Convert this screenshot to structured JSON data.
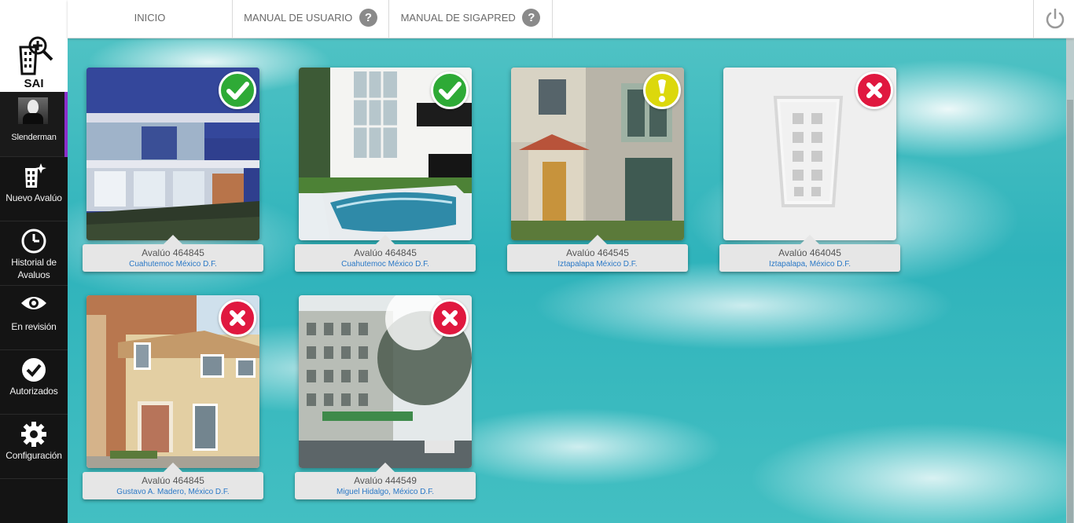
{
  "sidebar": {
    "logo_text": "SAI",
    "user_name": "Slenderman",
    "items": [
      {
        "label": "Nuevo Avalúo",
        "icon": "building-plus-icon"
      },
      {
        "label": "Historial de Avaluos",
        "icon": "clock-icon"
      },
      {
        "label": "En revisión",
        "icon": "eye-icon"
      },
      {
        "label": "Autorizados",
        "icon": "check-circle-icon"
      },
      {
        "label": "Configuración",
        "icon": "gear-icon"
      }
    ]
  },
  "topbar": {
    "nav": [
      {
        "label": "INICIO"
      },
      {
        "label": "MANUAL DE USUARIO",
        "help": "?"
      },
      {
        "label": "MANUAL DE SIGAPRED",
        "help": "?"
      }
    ],
    "power_icon": "power-icon"
  },
  "cards": [
    {
      "title": "Avalúo 464845",
      "location": "Cuahutemoc México D.F.",
      "status": "approved",
      "status_color": "#2eaa36"
    },
    {
      "title": "Avalúo 464845",
      "location": "Cuahutemoc México D.F.",
      "status": "approved",
      "status_color": "#2eaa36"
    },
    {
      "title": "Avalúo 464545",
      "location": "Iztapalapa México D.F.",
      "status": "warning",
      "status_color": "#dcd80c"
    },
    {
      "title": "Avalúo 464045",
      "location": "Iztapalapa, México D.F.",
      "status": "rejected",
      "status_color": "#e0183f"
    },
    {
      "title": "Avalúo 464845",
      "location": "Gustavo A. Madero, México D.F.",
      "status": "rejected",
      "status_color": "#e0183f"
    },
    {
      "title": "Avalúo 444549",
      "location": "Miguel Hidalgo, México D.F.",
      "status": "rejected",
      "status_color": "#e0183f"
    }
  ],
  "colors": {
    "sidebar_bg": "#141414",
    "active_accent": "#8b2fc9",
    "link_blue": "#2a78c6"
  }
}
